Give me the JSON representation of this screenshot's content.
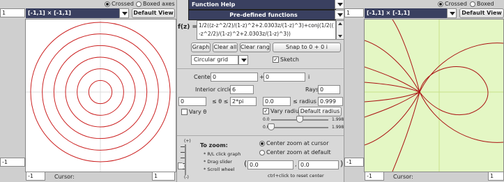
{
  "left": {
    "axes_mode_crossed": "Crossed",
    "axes_mode_boxed": "Boxed axes",
    "range_label": "[-1,1] × [-1,1]",
    "default_view": "Default View",
    "y_max": "1",
    "y_min": "-1",
    "x_min": "-1",
    "x_max": "1",
    "cursor_label": "Cursor:",
    "grid_color": "#cc2222",
    "circle_count": 6
  },
  "right": {
    "axes_mode_crossed": "Crossed",
    "axes_mode_boxed": "Boxed axes",
    "range_label": "[-1,1] × [-1,1]",
    "default_view": "Default View",
    "y_max": "1",
    "y_min": "-1",
    "x_min": "-1",
    "x_max": "1",
    "cursor_label": "Cursor:",
    "fill_color": "#e4f7c4",
    "curve_color": "#aa1111"
  },
  "middle": {
    "function_help": "Function Help",
    "predefined": "Pre-defined functions",
    "fz_label": "f(z) =",
    "formula_line1": "1/2((z-z^2/2)/(1-z)^2+2.0303z/(1-z)^3)+conj(1/2((",
    "formula_line2": "-z^2/2)/(1-z)^2+2.0303z/(1-z)^3))",
    "graph_btn": "Graph",
    "clear_all_btn": "Clear all",
    "clear_range_btn": "Clear range",
    "snap_btn": "Snap to 0 + 0 i",
    "grid_type": "Circular grid",
    "sketch_label": "Sketch",
    "sketch_checked": true,
    "center_label": "Center",
    "center_re": "0",
    "center_plus": "+",
    "center_im": "0",
    "center_i": "i",
    "interior_label": "Interior circles:",
    "interior_value": "6",
    "rays_label": "Rays:",
    "rays_value": "0",
    "theta_min": "0",
    "theta_leq": "≤ θ ≤",
    "theta_max": "2*pi",
    "radius_min": "0.0",
    "radius_leq": "≤ radius ≤",
    "radius_max": "0.999",
    "vary_theta": "Vary θ",
    "vary_theta_checked": false,
    "vary_radius": "Vary radius",
    "vary_radius_checked": true,
    "default_radius_btn": "Default radius",
    "slider1_left": "0.0",
    "slider1_right": "1.998",
    "slider1_value": 0.85,
    "slider2_left": "0.0",
    "slider2_right": "1.998",
    "slider2_value": 0.0,
    "zoom_plus": "(+)",
    "zoom_minus": "(-)",
    "to_zoom": "To zoom:",
    "zoom_hint1": "* R/L click graph",
    "zoom_hint2": "* Drag slider",
    "zoom_hint3": "* Scroll wheel",
    "center_cursor": "Center zoom at cursor",
    "center_default": "Center zoom at default",
    "zoom_re": "0.0",
    "zoom_im": "0.0",
    "ctrl_hint": "ctrl+click to reset center"
  }
}
